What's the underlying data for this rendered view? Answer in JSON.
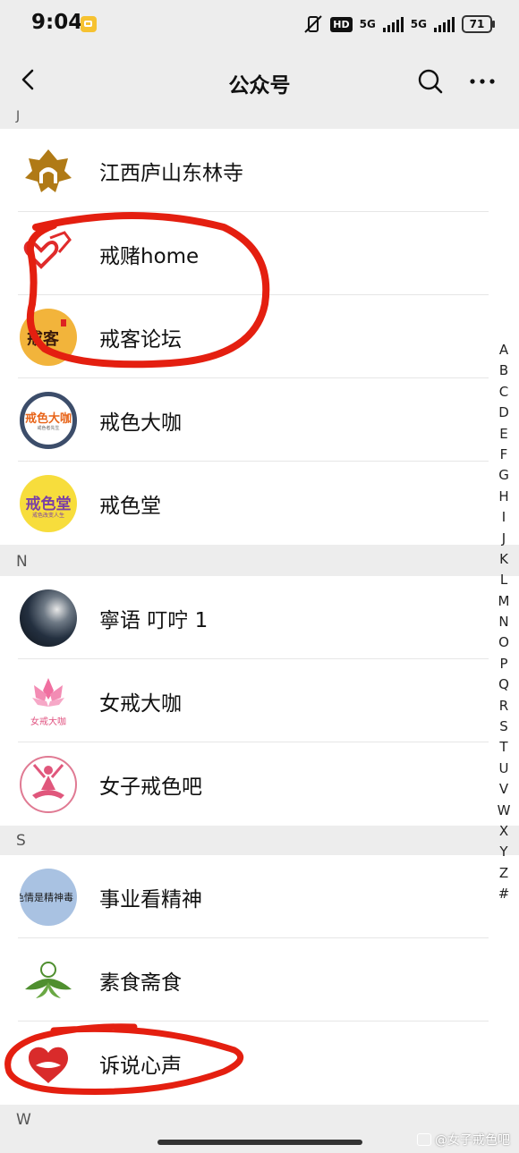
{
  "status_bar": {
    "time": "9:04",
    "hd_label": "HD",
    "network_1": "5G",
    "network_2": "5G",
    "battery": "71"
  },
  "header": {
    "title": "公众号"
  },
  "sections": [
    {
      "letter": "J",
      "items": [
        {
          "name": "江西庐山东林寺"
        },
        {
          "name": "戒赌home"
        },
        {
          "name": "戒客论坛"
        },
        {
          "name": "戒色大咖"
        },
        {
          "name": "戒色堂"
        }
      ]
    },
    {
      "letter": "N",
      "items": [
        {
          "name": "寧语 叮咛 1"
        },
        {
          "name": "女戒大咖"
        },
        {
          "name": "女子戒色吧"
        }
      ]
    },
    {
      "letter": "S",
      "items": [
        {
          "name": "事业看精神"
        },
        {
          "name": "素食斋食"
        },
        {
          "name": "诉说心声"
        }
      ]
    },
    {
      "letter": "W",
      "items": []
    }
  ],
  "avatar_text": {
    "jieke": "戒客",
    "jiese_dakai": "戒色大咖",
    "jiese_dakai_sub": "戒色者先生",
    "jiese_tang": "戒色堂",
    "jiese_tang_sub": "戒色改变人生",
    "nvjie": "女戒大咖",
    "shiye": "色情是精神毒"
  },
  "alphabet_index": [
    "A",
    "B",
    "C",
    "D",
    "E",
    "F",
    "G",
    "H",
    "I",
    "J",
    "K",
    "L",
    "M",
    "N",
    "O",
    "P",
    "Q",
    "R",
    "S",
    "T",
    "U",
    "V",
    "W",
    "X",
    "Y",
    "Z",
    "#"
  ],
  "watermark": "@女子戒色吧",
  "colors": {
    "annotation": "#e41f10",
    "header_bg": "#ededed",
    "list_bg": "#ffffff"
  }
}
